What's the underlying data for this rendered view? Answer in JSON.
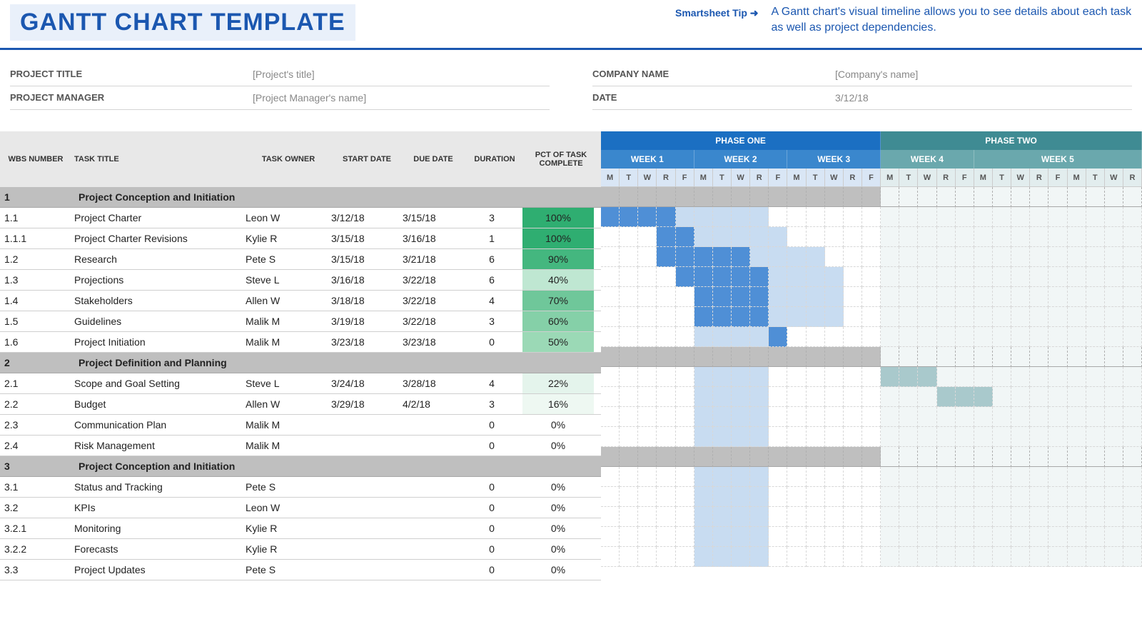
{
  "header": {
    "title": "GANTT CHART TEMPLATE",
    "tip_label": "Smartsheet Tip ➜",
    "tip_text": "A Gantt chart's visual timeline allows you to see details about each task as well as project dependencies."
  },
  "meta": {
    "left": [
      {
        "label": "PROJECT TITLE",
        "value": "[Project's title]"
      },
      {
        "label": "PROJECT MANAGER",
        "value": "[Project Manager's name]"
      }
    ],
    "right": [
      {
        "label": "COMPANY NAME",
        "value": "[Company's name]"
      },
      {
        "label": "DATE",
        "value": "3/12/18"
      }
    ]
  },
  "columns": {
    "wbs": "WBS NUMBER",
    "title": "TASK TITLE",
    "owner": "TASK OWNER",
    "start": "START DATE",
    "due": "DUE DATE",
    "duration": "DURATION",
    "pct": "PCT OF TASK COMPLETE"
  },
  "timeline": {
    "project_start_day_index": 0,
    "dayLetters": [
      "M",
      "T",
      "W",
      "R",
      "F"
    ],
    "phases": [
      {
        "name": "PHASE ONE",
        "weeks": [
          "WEEK 1",
          "WEEK 2",
          "WEEK 3"
        ],
        "phase_bg": "#1b6fc2",
        "week_bg": "#3a87cd",
        "day_bg": "#d9e6f5"
      },
      {
        "name": "PHASE TWO",
        "weeks": [
          "WEEK 4",
          "WEEK 5"
        ],
        "phase_bg": "#3f8b93",
        "week_bg": "#6aa8ad",
        "day_bg": "#e2edee"
      }
    ]
  },
  "pct_colors": {
    "100": "#2fae71",
    "90": "#44b77f",
    "70": "#6fc79a",
    "60": "#85d0a8",
    "50": "#9bd9b6",
    "40": "#bfe7d2",
    "22": "#e4f4ec",
    "16": "#eef8f2",
    "0": "#ffffff"
  },
  "bar_colors": {
    "phase1_strong": "#4f8fd6",
    "phase1_mid": "#8fb9e4",
    "phase1_light": "#c8dcf1",
    "phase2_mid": "#a9c9cc",
    "phase2_light": "#d4e5e7"
  },
  "sections": [
    {
      "wbs": "1",
      "title": "Project Conception and Initiation",
      "tasks": [
        {
          "wbs": "1.1",
          "title": "Project Charter",
          "owner": "Leon W",
          "start": "3/12/18",
          "due": "3/15/18",
          "duration": 3,
          "pct": 100,
          "bar": {
            "start": 0,
            "len": 4,
            "shade": "phase1_strong"
          },
          "shadow": {
            "start": 4,
            "len": 5,
            "shade": "phase1_light"
          }
        },
        {
          "wbs": "1.1.1",
          "title": "Project Charter Revisions",
          "owner": "Kylie R",
          "start": "3/15/18",
          "due": "3/16/18",
          "duration": 1,
          "pct": 100,
          "bar": {
            "start": 3,
            "len": 2,
            "shade": "phase1_strong"
          },
          "shadow": {
            "start": 5,
            "len": 5,
            "shade": "phase1_light"
          }
        },
        {
          "wbs": "1.2",
          "title": "Research",
          "owner": "Pete S",
          "start": "3/15/18",
          "due": "3/21/18",
          "duration": 6,
          "pct": 90,
          "bar": {
            "start": 3,
            "len": 5,
            "shade": "phase1_strong"
          },
          "shadow": {
            "start": 8,
            "len": 4,
            "shade": "phase1_light"
          }
        },
        {
          "wbs": "1.3",
          "title": "Projections",
          "owner": "Steve L",
          "start": "3/16/18",
          "due": "3/22/18",
          "duration": 6,
          "pct": 40,
          "bar": {
            "start": 4,
            "len": 5,
            "shade": "phase1_strong"
          },
          "shadow": {
            "start": 9,
            "len": 4,
            "shade": "phase1_light"
          }
        },
        {
          "wbs": "1.4",
          "title": "Stakeholders",
          "owner": "Allen W",
          "start": "3/18/18",
          "due": "3/22/18",
          "duration": 4,
          "pct": 70,
          "bar": {
            "start": 5,
            "len": 4,
            "shade": "phase1_strong"
          },
          "shadow": {
            "start": 9,
            "len": 4,
            "shade": "phase1_light"
          }
        },
        {
          "wbs": "1.5",
          "title": "Guidelines",
          "owner": "Malik M",
          "start": "3/19/18",
          "due": "3/22/18",
          "duration": 3,
          "pct": 60,
          "bar": {
            "start": 5,
            "len": 4,
            "shade": "phase1_strong"
          },
          "shadow": {
            "start": 9,
            "len": 4,
            "shade": "phase1_light"
          }
        },
        {
          "wbs": "1.6",
          "title": "Project Initiation",
          "owner": "Malik M",
          "start": "3/23/18",
          "due": "3/23/18",
          "duration": 0,
          "pct": 50,
          "bar": {
            "start": 9,
            "len": 1,
            "shade": "phase1_strong"
          },
          "shadow": {
            "start": 5,
            "len": 4,
            "shade": "phase1_light"
          }
        }
      ]
    },
    {
      "wbs": "2",
      "title": "Project Definition and Planning",
      "tasks": [
        {
          "wbs": "2.1",
          "title": "Scope and Goal Setting",
          "owner": "Steve L",
          "start": "3/24/18",
          "due": "3/28/18",
          "duration": 4,
          "pct": 22,
          "bar": {
            "start": 15,
            "len": 3,
            "shade": "phase2_mid"
          },
          "shadow": {
            "start": 5,
            "len": 4,
            "shade": "phase1_light"
          }
        },
        {
          "wbs": "2.2",
          "title": "Budget",
          "owner": "Allen W",
          "start": "3/29/18",
          "due": "4/2/18",
          "duration": 3,
          "pct": 16,
          "bar": {
            "start": 18,
            "len": 3,
            "shade": "phase2_mid"
          },
          "shadow": {
            "start": 5,
            "len": 4,
            "shade": "phase1_light"
          }
        },
        {
          "wbs": "2.3",
          "title": "Communication Plan",
          "owner": "Malik M",
          "start": "",
          "due": "",
          "duration": 0,
          "pct": 0,
          "shadow": {
            "start": 5,
            "len": 4,
            "shade": "phase1_light"
          }
        },
        {
          "wbs": "2.4",
          "title": "Risk Management",
          "owner": "Malik M",
          "start": "",
          "due": "",
          "duration": 0,
          "pct": 0,
          "shadow": {
            "start": 5,
            "len": 4,
            "shade": "phase1_light"
          }
        }
      ]
    },
    {
      "wbs": "3",
      "title": "Project Conception and Initiation",
      "tasks": [
        {
          "wbs": "3.1",
          "title": "Status and Tracking",
          "owner": "Pete S",
          "start": "",
          "due": "",
          "duration": 0,
          "pct": 0,
          "shadow": {
            "start": 5,
            "len": 4,
            "shade": "phase1_light"
          }
        },
        {
          "wbs": "3.2",
          "title": "KPIs",
          "owner": "Leon W",
          "start": "",
          "due": "",
          "duration": 0,
          "pct": 0,
          "shadow": {
            "start": 5,
            "len": 4,
            "shade": "phase1_light"
          }
        },
        {
          "wbs": "3.2.1",
          "title": "Monitoring",
          "owner": "Kylie R",
          "start": "",
          "due": "",
          "duration": 0,
          "pct": 0,
          "shadow": {
            "start": 5,
            "len": 4,
            "shade": "phase1_light"
          }
        },
        {
          "wbs": "3.2.2",
          "title": "Forecasts",
          "owner": "Kylie R",
          "start": "",
          "due": "",
          "duration": 0,
          "pct": 0,
          "shadow": {
            "start": 5,
            "len": 4,
            "shade": "phase1_light"
          }
        },
        {
          "wbs": "3.3",
          "title": "Project Updates",
          "owner": "Pete S",
          "start": "",
          "due": "",
          "duration": 0,
          "pct": 0,
          "shadow": {
            "start": 5,
            "len": 4,
            "shade": "phase1_light"
          }
        }
      ]
    }
  ],
  "chart_data": {
    "type": "gantt",
    "title": "GANTT CHART TEMPLATE",
    "start_date": "3/12/18",
    "time_unit": "weekday",
    "columns_per_week": 5,
    "weeks": [
      "WEEK 1",
      "WEEK 2",
      "WEEK 3",
      "WEEK 4",
      "WEEK 5"
    ],
    "phases": [
      {
        "name": "PHASE ONE",
        "weeks": [
          1,
          2,
          3
        ]
      },
      {
        "name": "PHASE TWO",
        "weeks": [
          4,
          5
        ]
      }
    ],
    "tasks": [
      {
        "id": "1.1",
        "name": "Project Charter",
        "owner": "Leon W",
        "start": "3/12/18",
        "end": "3/15/18",
        "duration": 3,
        "pct_complete": 100
      },
      {
        "id": "1.1.1",
        "name": "Project Charter Revisions",
        "owner": "Kylie R",
        "start": "3/15/18",
        "end": "3/16/18",
        "duration": 1,
        "pct_complete": 100
      },
      {
        "id": "1.2",
        "name": "Research",
        "owner": "Pete S",
        "start": "3/15/18",
        "end": "3/21/18",
        "duration": 6,
        "pct_complete": 90
      },
      {
        "id": "1.3",
        "name": "Projections",
        "owner": "Steve L",
        "start": "3/16/18",
        "end": "3/22/18",
        "duration": 6,
        "pct_complete": 40
      },
      {
        "id": "1.4",
        "name": "Stakeholders",
        "owner": "Allen W",
        "start": "3/18/18",
        "end": "3/22/18",
        "duration": 4,
        "pct_complete": 70
      },
      {
        "id": "1.5",
        "name": "Guidelines",
        "owner": "Malik M",
        "start": "3/19/18",
        "end": "3/22/18",
        "duration": 3,
        "pct_complete": 60
      },
      {
        "id": "1.6",
        "name": "Project Initiation",
        "owner": "Malik M",
        "start": "3/23/18",
        "end": "3/23/18",
        "duration": 0,
        "pct_complete": 50
      },
      {
        "id": "2.1",
        "name": "Scope and Goal Setting",
        "owner": "Steve L",
        "start": "3/24/18",
        "end": "3/28/18",
        "duration": 4,
        "pct_complete": 22
      },
      {
        "id": "2.2",
        "name": "Budget",
        "owner": "Allen W",
        "start": "3/29/18",
        "end": "4/2/18",
        "duration": 3,
        "pct_complete": 16
      },
      {
        "id": "2.3",
        "name": "Communication Plan",
        "owner": "Malik M",
        "start": null,
        "end": null,
        "duration": 0,
        "pct_complete": 0
      },
      {
        "id": "2.4",
        "name": "Risk Management",
        "owner": "Malik M",
        "start": null,
        "end": null,
        "duration": 0,
        "pct_complete": 0
      },
      {
        "id": "3.1",
        "name": "Status and Tracking",
        "owner": "Pete S",
        "start": null,
        "end": null,
        "duration": 0,
        "pct_complete": 0
      },
      {
        "id": "3.2",
        "name": "KPIs",
        "owner": "Leon W",
        "start": null,
        "end": null,
        "duration": 0,
        "pct_complete": 0
      },
      {
        "id": "3.2.1",
        "name": "Monitoring",
        "owner": "Kylie R",
        "start": null,
        "end": null,
        "duration": 0,
        "pct_complete": 0
      },
      {
        "id": "3.2.2",
        "name": "Forecasts",
        "owner": "Kylie R",
        "start": null,
        "end": null,
        "duration": 0,
        "pct_complete": 0
      },
      {
        "id": "3.3",
        "name": "Project Updates",
        "owner": "Pete S",
        "start": null,
        "end": null,
        "duration": 0,
        "pct_complete": 0
      }
    ]
  }
}
